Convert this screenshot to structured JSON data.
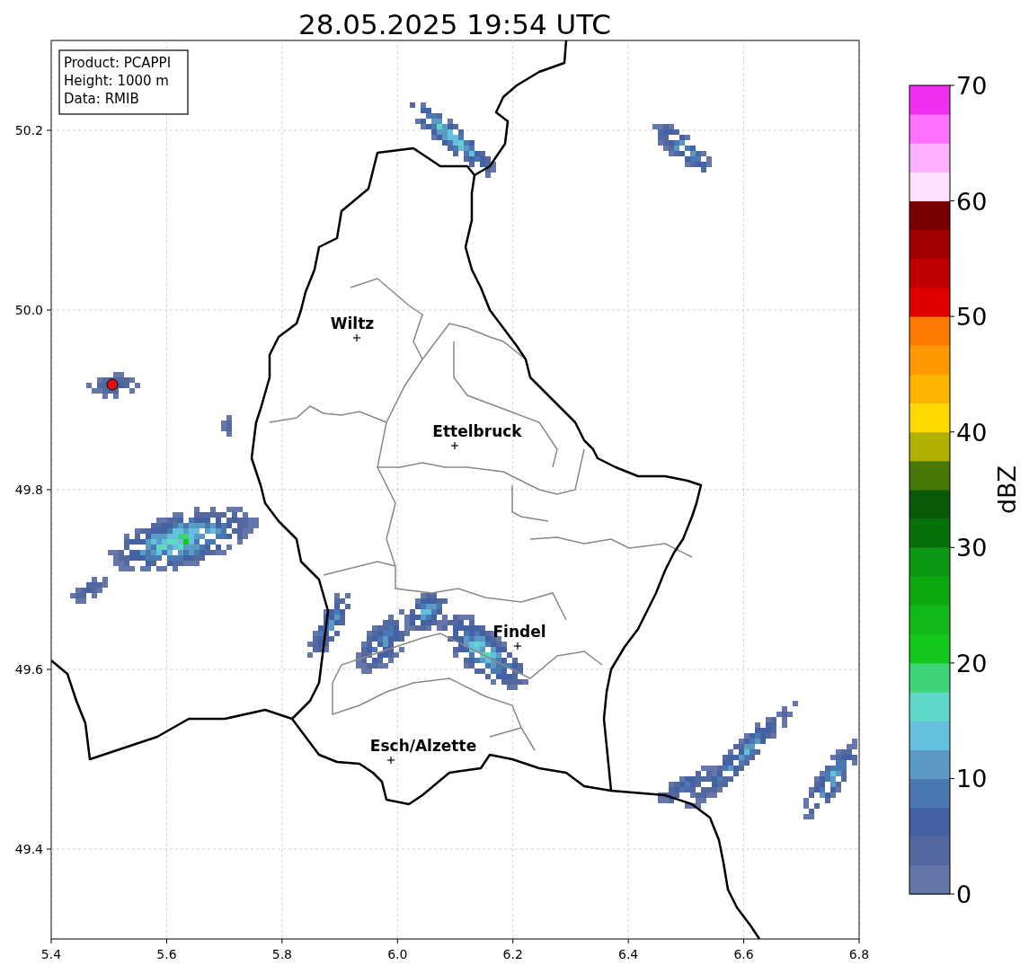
{
  "title": "28.05.2025 19:54 UTC",
  "info_box": [
    "Product: PCAPPI",
    "Height: 1000 m",
    "Data: RMIB"
  ],
  "map": {
    "cities": [
      {
        "name": "Wiltz"
      },
      {
        "name": "Ettelbruck"
      },
      {
        "name": "Findel"
      },
      {
        "name": "Esch/Alzette"
      }
    ],
    "xticks": [
      "5.4",
      "5.6",
      "5.8",
      "6.0",
      "6.2",
      "6.4",
      "6.6",
      "6.8"
    ],
    "yticks": [
      "50.2",
      "50.0",
      "49.8",
      "49.6",
      "49.4"
    ]
  },
  "colorbar": {
    "label": "dBZ",
    "ticks": [
      "70",
      "60",
      "50",
      "40",
      "30",
      "20",
      "10",
      "0"
    ]
  }
}
